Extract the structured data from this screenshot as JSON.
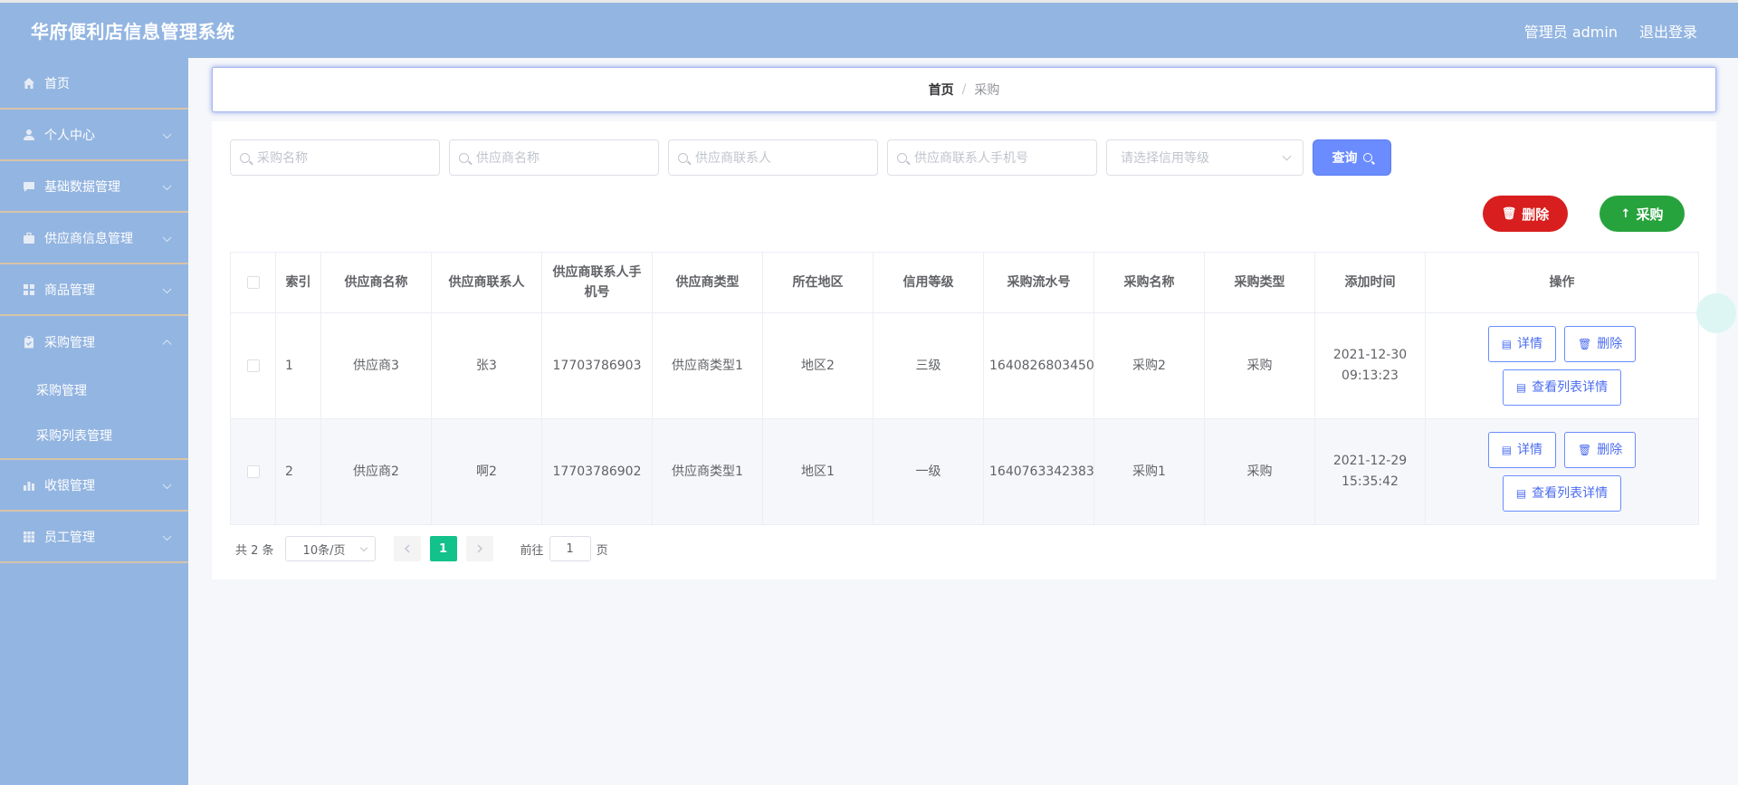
{
  "header": {
    "title": "华府便利店信息管理系统",
    "user_label": "管理员 admin",
    "logout_label": "退出登录"
  },
  "sidebar": {
    "items": [
      {
        "label": "首页",
        "icon": "home-icon"
      },
      {
        "label": "个人中心",
        "icon": "user-icon"
      },
      {
        "label": "基础数据管理",
        "icon": "chat-icon"
      },
      {
        "label": "供应商信息管理",
        "icon": "briefcase-icon"
      },
      {
        "label": "商品管理",
        "icon": "grid-icon"
      },
      {
        "label": "采购管理",
        "icon": "clipboard-icon"
      },
      {
        "label": "收银管理",
        "icon": "chart-icon"
      },
      {
        "label": "员工管理",
        "icon": "apps-icon"
      }
    ],
    "sub_items": [
      "采购管理",
      "采购列表管理"
    ]
  },
  "breadcrumb": {
    "home": "首页",
    "separator": "/",
    "current": "采购"
  },
  "search": {
    "purchase_name_placeholder": "采购名称",
    "supplier_name_placeholder": "供应商名称",
    "contact_placeholder": "供应商联系人",
    "phone_placeholder": "供应商联系人手机号",
    "credit_placeholder": "请选择信用等级",
    "query_label": "查询"
  },
  "actions": {
    "delete_label": "删除",
    "purchase_label": "采购"
  },
  "table": {
    "headers": [
      "索引",
      "供应商名称",
      "供应商联系人",
      "供应商联系人手机号",
      "供应商类型",
      "所在地区",
      "信用等级",
      "采购流水号",
      "采购名称",
      "采购类型",
      "添加时间",
      "操作"
    ],
    "rows": [
      {
        "index": "1",
        "supplier": "供应商3",
        "contact": "张3",
        "phone": "17703786903",
        "type": "供应商类型1",
        "region": "地区2",
        "credit": "三级",
        "serial": "1640826803450",
        "name": "采购2",
        "ptype": "采购",
        "time": "2021-12-30 09:13:23"
      },
      {
        "index": "2",
        "supplier": "供应商2",
        "contact": "啊2",
        "phone": "17703786902",
        "type": "供应商类型1",
        "region": "地区1",
        "credit": "一级",
        "serial": "1640763342383",
        "name": "采购1",
        "ptype": "采购",
        "time": "2021-12-29 15:35:42"
      }
    ],
    "ops": {
      "detail": "详情",
      "delete": "删除",
      "list_detail": "查看列表详情"
    }
  },
  "pager": {
    "total": "共 2 条",
    "page_size": "10条/页",
    "current_page": "1",
    "goto_prefix": "前往",
    "goto_value": "1",
    "goto_suffix": "页"
  },
  "colors": {
    "header_bg": "#93b5e1",
    "delete_red": "#d81e1e",
    "purchase_green": "#27a33d",
    "query_blue": "#6b8cff",
    "page_active": "#13c18b"
  }
}
